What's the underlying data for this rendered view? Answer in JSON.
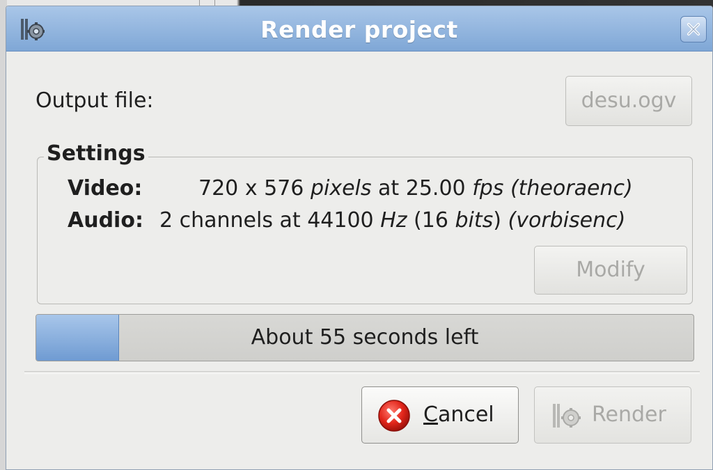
{
  "window": {
    "title": "Render project",
    "icon": "render-gear-icon"
  },
  "output": {
    "label": "Output file:",
    "file_name": "desu.ogv"
  },
  "settings": {
    "title": "Settings",
    "video": {
      "label": "Video:",
      "width": "720",
      "times": "x",
      "height": "576",
      "pixels": "pixels",
      "at": "at",
      "fps_value": "25.00",
      "fps_unit": "fps",
      "encoder": "(theoraenc)"
    },
    "audio": {
      "label": "Audio:",
      "channels": "2 channels at",
      "rate": "44100",
      "rate_unit": "Hz",
      "bits_open": "(16",
      "bits_unit": "bits",
      "bits_close": ")",
      "encoder": "(vorbisenc)"
    },
    "modify_label": "Modify"
  },
  "progress": {
    "fraction": 0.125,
    "text": "About 55 seconds left"
  },
  "buttons": {
    "cancel_mnemonic": "C",
    "cancel_rest": "ancel",
    "render_label": "Render"
  },
  "colors": {
    "titlebar": "#7fa7d6",
    "progress_fill": "#6f9bd2",
    "cancel_icon": "#d9261c"
  }
}
